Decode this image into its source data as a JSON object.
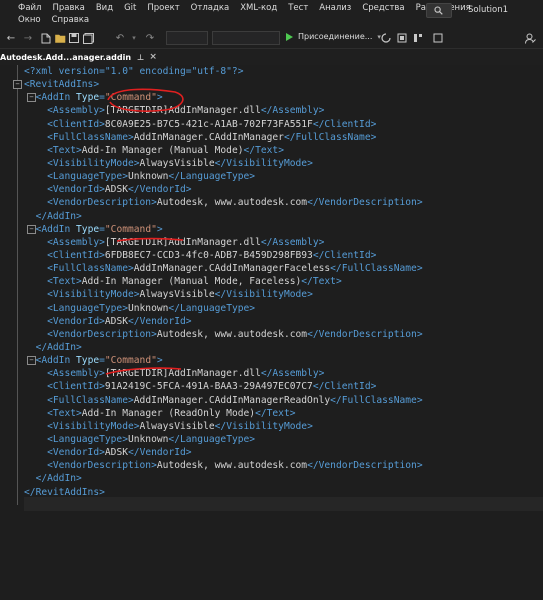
{
  "menu": {
    "row1": [
      "Файл",
      "Правка",
      "Вид",
      "Git",
      "Проект",
      "Отладка",
      "XML-код",
      "Тест",
      "Анализ",
      "Средства",
      "Расширения"
    ],
    "row2": [
      "Окно",
      "Справка"
    ]
  },
  "window": {
    "solution": "Solution1"
  },
  "toolbar": {
    "run_label": "Присоединение..."
  },
  "tab": {
    "title": "Autodesk.Add...anager.addin"
  },
  "code": {
    "declaration": "<?xml version=\"1.0\" encoding=\"utf-8\"?>",
    "root_open": "RevitAddIns",
    "root_close": "RevitAddIns",
    "addin_tag": "AddIn",
    "type_attr": "Type",
    "type_value": "\"Command\"",
    "field_names": [
      "Assembly",
      "ClientId",
      "FullClassName",
      "Text",
      "VisibilityMode",
      "LanguageType",
      "VendorId",
      "VendorDescription"
    ],
    "addins": [
      {
        "values": [
          "[TARGETDIR]AddInManager.dll",
          "8C0A9E25-B7C5-421c-A1AB-702F73FA551F",
          "AddInManager.CAddInManager",
          "Add-In Manager (Manual Mode)",
          "AlwaysVisible",
          "Unknown",
          "ADSK",
          "Autodesk, www.autodesk.com"
        ]
      },
      {
        "values": [
          "[TARGETDIR]AddInManager.dll",
          "6FDB8EC7-CCD3-4fc0-ADB7-B459D298FB93",
          "AddInManager.CAddInManagerFaceless",
          "Add-In Manager (Manual Mode, Faceless)",
          "AlwaysVisible",
          "Unknown",
          "ADSK",
          "Autodesk, www.autodesk.com"
        ]
      },
      {
        "values": [
          "[TARGETDIR]AddInManager.dll",
          "91A2419C-5FCA-491A-BAA3-29A497EC07C7",
          "AddInManager.CAddInManagerReadOnly",
          "Add-In Manager (ReadOnly Mode)",
          "AlwaysVisible",
          "Unknown",
          "ADSK",
          "Autodesk, www.autodesk.com"
        ]
      }
    ]
  },
  "colors": {
    "tag": "#569cd6",
    "attribute": "#9cdcfe",
    "string": "#ce9178",
    "text": "#d4d4d4",
    "annotation": "#e02020",
    "accent": "#8f6ad3"
  },
  "icons": [
    "back-icon",
    "forward-icon",
    "new-item-icon",
    "open-icon",
    "save-icon",
    "save-all-icon",
    "undo-icon",
    "redo-icon",
    "play-icon",
    "search-icon",
    "pin-icon",
    "close-icon"
  ]
}
